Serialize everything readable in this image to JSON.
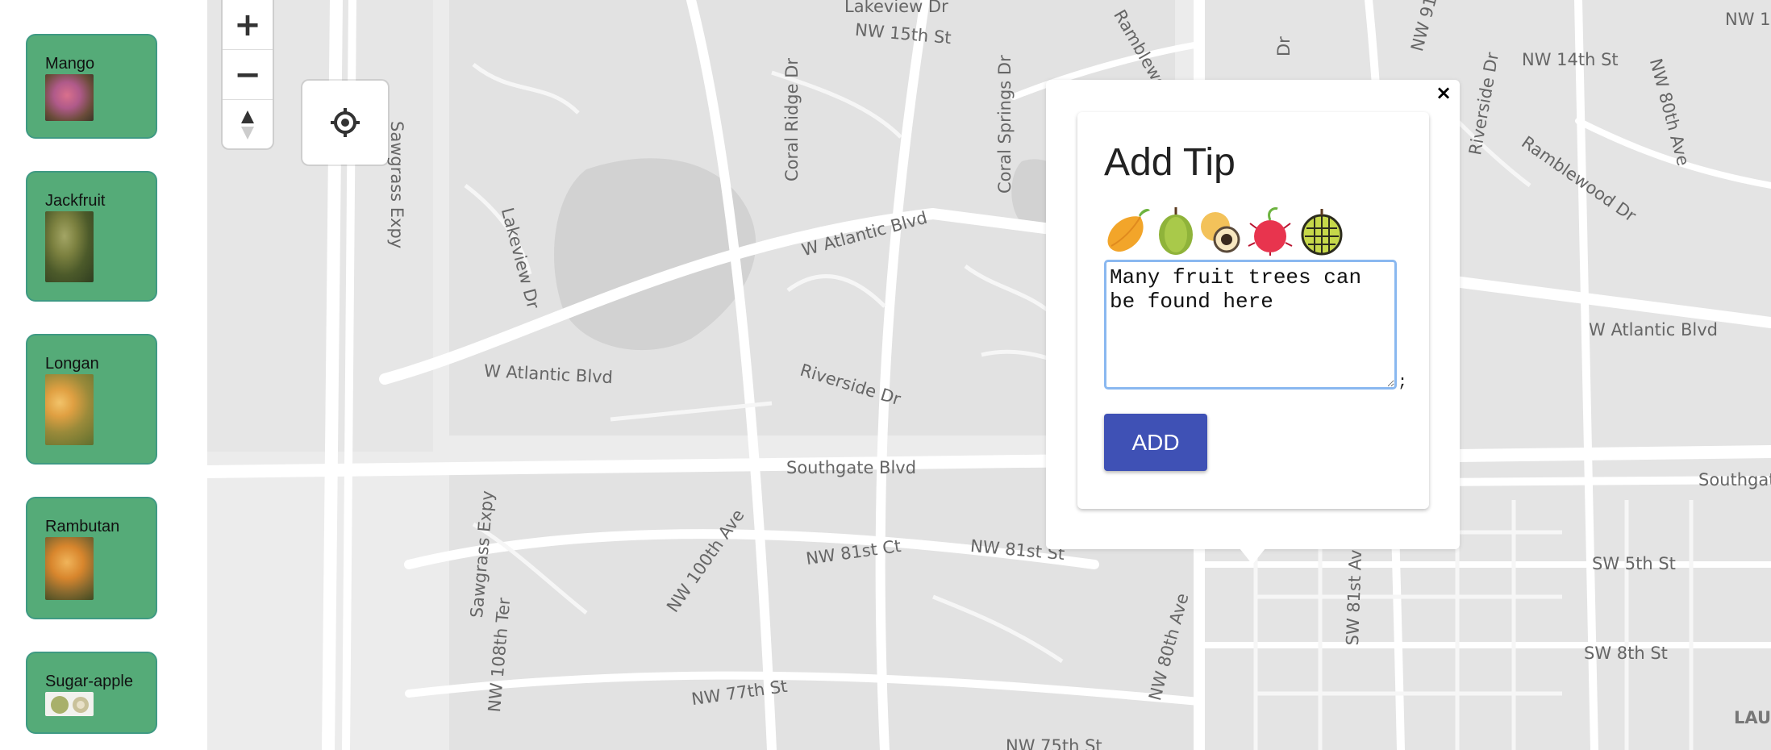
{
  "sidebar": {
    "fruits": [
      {
        "label": "Mango"
      },
      {
        "label": "Jackfruit"
      },
      {
        "label": "Longan"
      },
      {
        "label": "Rambutan"
      },
      {
        "label": "Sugar-apple"
      }
    ]
  },
  "map": {
    "street_labels": [
      "Lakeview Dr",
      "NW 15th St",
      "NW 14th St",
      "Sawgrass Expy",
      "Lakeview Dr",
      "Coral Ridge Dr",
      "Coral Springs Dr",
      "W Atlantic Blvd",
      "W Atlantic Blvd",
      "Riverside Dr",
      "Riverside Dr",
      "Ramblewood Dr",
      "W Atlantic Blvd",
      "Southgate Blvd",
      "Southgat",
      "Sawgrass Expy",
      "NW 100th Ave",
      "NW 81st Ct",
      "NW 81st St",
      "NW 108th Ter",
      "NW 77th St",
      "NW 80th Ave",
      "SW 81st Ave",
      "SW 5th St",
      "SW 8th St",
      "NW 80th Ave",
      "NW 91st Ave",
      "Ramblewoo",
      "Dr",
      "NW 1",
      "LAU",
      "NW 75th St"
    ],
    "pin_color": "#2e7d1f"
  },
  "controls": {
    "zoom_in": "+",
    "zoom_out": "−",
    "compass_icon": "compass-icon",
    "locate_icon": "geolocate-icon"
  },
  "popup": {
    "close_label": "×",
    "title": "Add Tip",
    "fruit_icons": [
      "mango-icon",
      "jackfruit-icon",
      "longan-icon",
      "rambutan-icon",
      "sugar-apple-icon"
    ],
    "tip_text": "Many fruit trees can be found here",
    "stray_char": ";",
    "add_label": "ADD",
    "add_color": "#3f51b5"
  }
}
